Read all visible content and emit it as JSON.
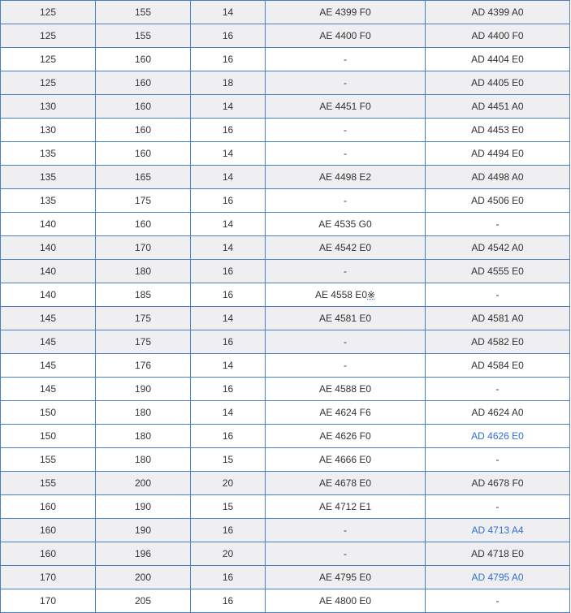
{
  "rows": [
    {
      "c1": "125",
      "c2": "155",
      "c3": "14",
      "ae": "AE 4399 F0",
      "ad": "AD 4399 A0",
      "ad_link": false,
      "mark": ""
    },
    {
      "c1": "125",
      "c2": "155",
      "c3": "16",
      "ae": "AE 4400 F0",
      "ad": "AD 4400 F0",
      "ad_link": false,
      "mark": ""
    },
    {
      "c1": "125",
      "c2": "160",
      "c3": "16",
      "ae": "-",
      "ad": "AD 4404 E0",
      "ad_link": false,
      "mark": ""
    },
    {
      "c1": "125",
      "c2": "160",
      "c3": "18",
      "ae": "-",
      "ad": "AD 4405 E0",
      "ad_link": false,
      "mark": ""
    },
    {
      "c1": "130",
      "c2": "160",
      "c3": "14",
      "ae": "AE 4451 F0",
      "ad": "AD 4451 A0",
      "ad_link": false,
      "mark": ""
    },
    {
      "c1": "130",
      "c2": "160",
      "c3": "16",
      "ae": "-",
      "ad": "AD 4453 E0",
      "ad_link": false,
      "mark": ""
    },
    {
      "c1": "135",
      "c2": "160",
      "c3": "14",
      "ae": "-",
      "ad": "AD 4494 E0",
      "ad_link": false,
      "mark": ""
    },
    {
      "c1": "135",
      "c2": "165",
      "c3": "14",
      "ae": "AE 4498 E2",
      "ad": "AD 4498 A0",
      "ad_link": false,
      "mark": ""
    },
    {
      "c1": "135",
      "c2": "175",
      "c3": "16",
      "ae": "-",
      "ad": "AD 4506 E0",
      "ad_link": false,
      "mark": ""
    },
    {
      "c1": "140",
      "c2": "160",
      "c3": "14",
      "ae": "AE 4535 G0",
      "ad": "-",
      "ad_link": false,
      "mark": ""
    },
    {
      "c1": "140",
      "c2": "170",
      "c3": "14",
      "ae": "AE 4542 E0",
      "ad": "AD 4542 A0",
      "ad_link": false,
      "mark": ""
    },
    {
      "c1": "140",
      "c2": "180",
      "c3": "16",
      "ae": "-",
      "ad": "AD 4555 E0",
      "ad_link": false,
      "mark": ""
    },
    {
      "c1": "140",
      "c2": "185",
      "c3": "16",
      "ae": "AE 4558 E0",
      "ad": "-",
      "ad_link": false,
      "mark": "※"
    },
    {
      "c1": "145",
      "c2": "175",
      "c3": "14",
      "ae": "AE 4581 E0",
      "ad": "AD 4581 A0",
      "ad_link": false,
      "mark": ""
    },
    {
      "c1": "145",
      "c2": "175",
      "c3": "16",
      "ae": "-",
      "ad": "AD 4582 E0",
      "ad_link": false,
      "mark": ""
    },
    {
      "c1": "145",
      "c2": "176",
      "c3": "14",
      "ae": "-",
      "ad": "AD 4584 E0",
      "ad_link": false,
      "mark": ""
    },
    {
      "c1": "145",
      "c2": "190",
      "c3": "16",
      "ae": "AE 4588 E0",
      "ad": "-",
      "ad_link": false,
      "mark": ""
    },
    {
      "c1": "150",
      "c2": "180",
      "c3": "14",
      "ae": "AE 4624 F6",
      "ad": "AD 4624 A0",
      "ad_link": false,
      "mark": ""
    },
    {
      "c1": "150",
      "c2": "180",
      "c3": "16",
      "ae": "AE 4626 F0",
      "ad": "AD 4626 E0",
      "ad_link": true,
      "mark": ""
    },
    {
      "c1": "155",
      "c2": "180",
      "c3": "15",
      "ae": "AE 4666 E0",
      "ad": "-",
      "ad_link": false,
      "mark": ""
    },
    {
      "c1": "155",
      "c2": "200",
      "c3": "20",
      "ae": "AE 4678 E0",
      "ad": "AD 4678 F0",
      "ad_link": false,
      "mark": ""
    },
    {
      "c1": "160",
      "c2": "190",
      "c3": "15",
      "ae": "AE 4712 E1",
      "ad": "-",
      "ad_link": false,
      "mark": ""
    },
    {
      "c1": "160",
      "c2": "190",
      "c3": "16",
      "ae": "-",
      "ad": "AD 4713 A4",
      "ad_link": true,
      "mark": ""
    },
    {
      "c1": "160",
      "c2": "196",
      "c3": "20",
      "ae": "-",
      "ad": "AD 4718 E0",
      "ad_link": false,
      "mark": ""
    },
    {
      "c1": "170",
      "c2": "200",
      "c3": "16",
      "ae": "AE 4795 E0",
      "ad": "AD 4795 A0",
      "ad_link": true,
      "mark": ""
    },
    {
      "c1": "170",
      "c2": "205",
      "c3": "16",
      "ae": "AE 4800 E0",
      "ad": "-",
      "ad_link": false,
      "mark": ""
    }
  ],
  "colors": {
    "border": "#4a7ec5",
    "shaded_row": "#efeff1",
    "plain_row": "#ffffff",
    "text": "#333333",
    "link": "#2f6fd6"
  },
  "shading": [
    "shaded",
    "shaded",
    "plain",
    "shaded",
    "shaded",
    "plain",
    "plain",
    "shaded",
    "plain",
    "plain",
    "shaded",
    "shaded",
    "plain",
    "shaded",
    "shaded",
    "plain",
    "plain",
    "plain",
    "plain",
    "plain",
    "shaded",
    "plain",
    "shaded",
    "shaded",
    "shaded",
    "plain"
  ]
}
